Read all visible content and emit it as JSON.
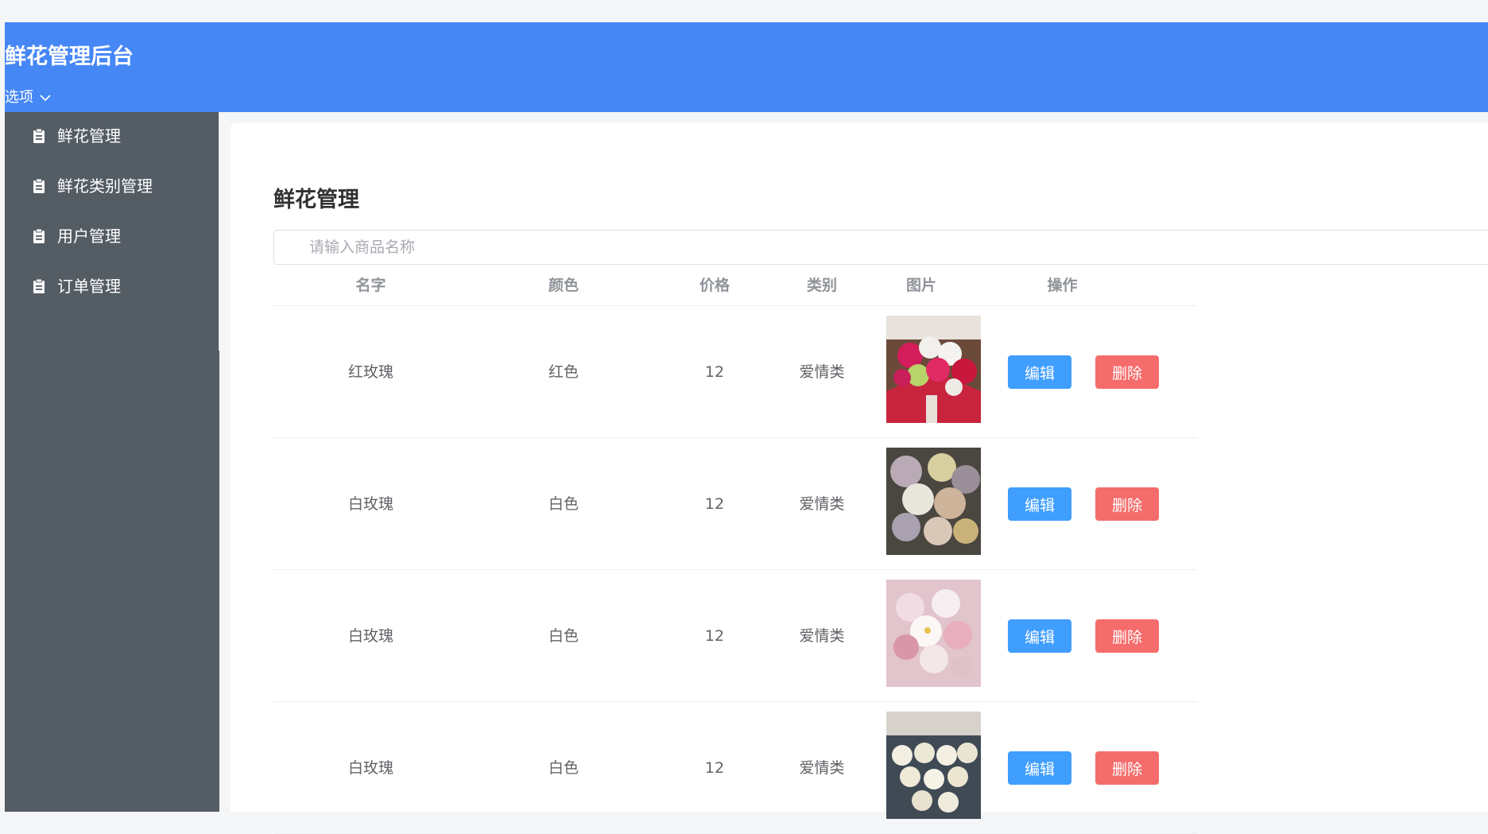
{
  "header": {
    "title": "鲜花管理后台",
    "options_label": "选项",
    "background": "#4687f6"
  },
  "sidebar": {
    "background": "#545c64",
    "items": [
      {
        "label": "鲜花管理",
        "icon": "clipboard-icon"
      },
      {
        "label": "鲜花类别管理",
        "icon": "clipboard-icon"
      },
      {
        "label": "用户管理",
        "icon": "clipboard-icon"
      },
      {
        "label": "订单管理",
        "icon": "clipboard-icon"
      }
    ]
  },
  "main": {
    "title": "鲜花管理",
    "search_placeholder": "请输入商品名称",
    "columns": [
      "名字",
      "颜色",
      "价格",
      "类别",
      "图片",
      "操作"
    ],
    "rows": [
      {
        "name": "红玫瑰",
        "color": "红色",
        "price": "12",
        "category": "爱情类",
        "image": "red-rose-bouquet-photo",
        "edit": "编辑",
        "delete": "删除"
      },
      {
        "name": "白玫瑰",
        "color": "白色",
        "price": "12",
        "category": "爱情类",
        "image": "pastel-bouquet-photo",
        "edit": "编辑",
        "delete": "删除"
      },
      {
        "name": "白玫瑰",
        "color": "白色",
        "price": "12",
        "category": "爱情类",
        "image": "pink-orchid-bouquet-photo",
        "edit": "编辑",
        "delete": "删除"
      },
      {
        "name": "白玫瑰",
        "color": "白色",
        "price": "12",
        "category": "爱情类",
        "image": "white-rose-bouquet-photo",
        "edit": "编辑",
        "delete": "删除"
      }
    ]
  },
  "colors": {
    "edit_button": "#409eff",
    "delete_button": "#f56c6c"
  }
}
